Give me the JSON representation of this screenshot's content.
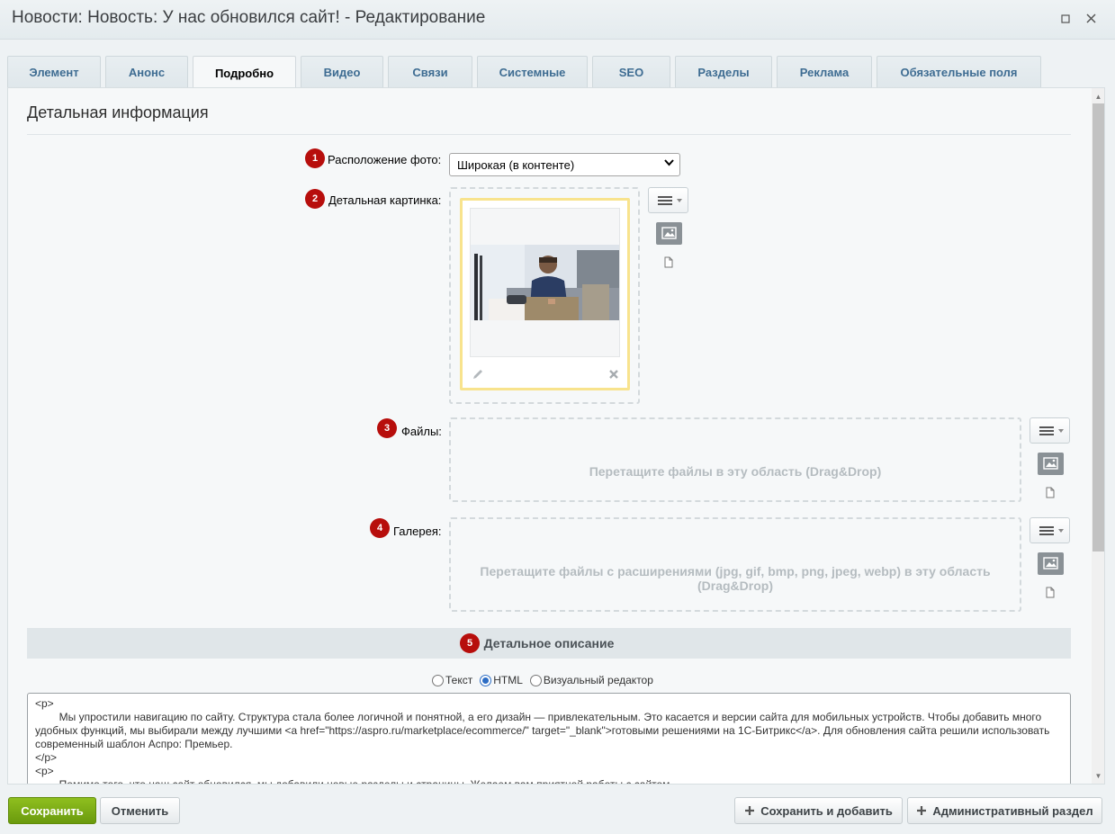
{
  "window": {
    "title": "Новости: Новость: У нас обновился сайт! - Редактирование"
  },
  "tabs": [
    {
      "label": "Элемент"
    },
    {
      "label": "Анонс"
    },
    {
      "label": "Подробно"
    },
    {
      "label": "Видео"
    },
    {
      "label": "Связи"
    },
    {
      "label": "Системные"
    },
    {
      "label": "SEO"
    },
    {
      "label": "Разделы"
    },
    {
      "label": "Реклама"
    },
    {
      "label": "Обязательные поля"
    }
  ],
  "active_tab": "Подробно",
  "form": {
    "section_title": "Детальная информация",
    "photo_position": {
      "badge": "1",
      "label": "Расположение фото:",
      "value": "Широкая (в контенте)"
    },
    "detail_picture": {
      "badge": "2",
      "label": "Детальная картинка:"
    },
    "files": {
      "badge": "3",
      "label": "Файлы:",
      "dropzone_text": "Перетащите файлы в эту область (Drag&Drop)"
    },
    "gallery": {
      "badge": "4",
      "label": "Галерея:",
      "dropzone_text_1": "Перетащите файлы с расширениями (jpg, gif, bmp, png, jpeg, webp) в эту область",
      "dropzone_text_2": "(Drag&Drop)"
    },
    "description": {
      "badge": "5",
      "title": "Детальное описание",
      "modes": [
        "Текст",
        "HTML",
        "Визуальный редактор"
      ],
      "selected_mode": "HTML",
      "content": "<p>\n        Мы упростили навигацию по сайту. Структура стала более логичной и понятной, а его дизайн — привлекательным. Это касается и версии сайта для мобильных устройств. Чтобы добавить много удобных функций, мы выбирали между лучшими <a href=\"https://aspro.ru/marketplace/ecommerce/\" target=\"_blank\">готовыми решениями на 1С-Битрикс</a>. Для обновления сайта решили использовать современный шаблон Аспро: Премьер.\n</p>\n<p>\n        Помимо того, что наш сайт обновился, мы добавили новые разделы и страницы. Желаем вам приятной работы с сайтом."
    }
  },
  "footer": {
    "save": "Сохранить",
    "cancel": "Отменить",
    "save_add": "Сохранить и добавить",
    "admin_section": "Административный раздел"
  },
  "colors": {
    "badge": "#b70e0c",
    "tab_text": "#3e6c92",
    "save_button": "#7aab14"
  }
}
